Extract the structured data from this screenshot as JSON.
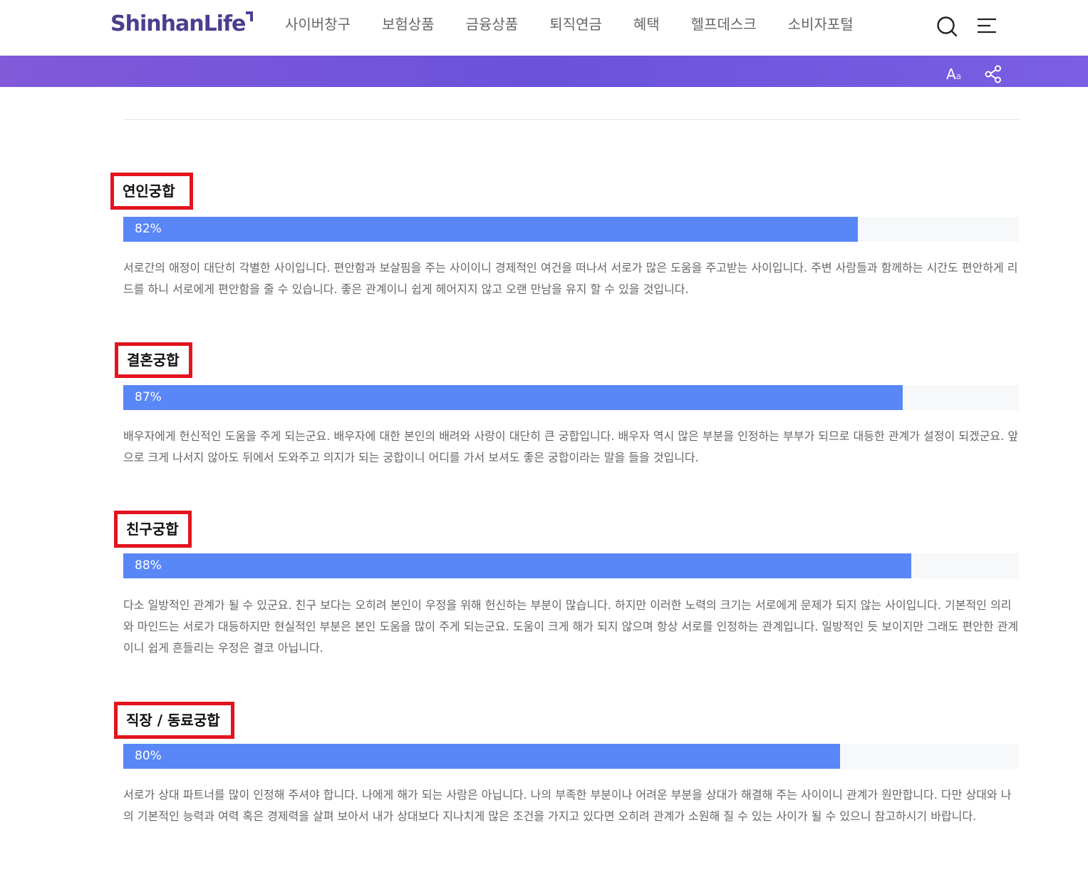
{
  "header": {
    "logo": "ShinhanLife",
    "nav": [
      "사이버창구",
      "보험상품",
      "금융상품",
      "퇴직연금",
      "혜택",
      "헬프데스크",
      "소비자포털"
    ]
  },
  "toolbar": {
    "font_size_big": "A",
    "font_size_small": "a"
  },
  "sections": [
    {
      "title": "연인궁합",
      "percent_label": "82%",
      "percent": 82,
      "description": "서로간의 애정이 대단히 각별한 사이입니다. 편안함과 보살핌을 주는 사이이니 경제적인 여건을 떠나서 서로가 많은 도움을 주고받는 사이입니다. 주변 사람들과 함께하는 시간도 편안하게 리드를 하니 서로에게 편안함을 줄 수 있습니다. 좋은 관계이니 쉽게 헤어지지 않고 오랜 만남을 유지 할 수 있을 것입니다."
    },
    {
      "title": "결혼궁합",
      "percent_label": "87%",
      "percent": 87,
      "description": "배우자에게 헌신적인 도움을 주게 되는군요. 배우자에 대한 본인의 배려와 사랑이 대단히 큰 궁합입니다. 배우자 역시 많은 부분을 인정하는 부부가 되므로 대등한 관계가 설정이 되겠군요. 앞으로 크게 나서지 않아도 뒤에서 도와주고 의지가 되는 궁합이니 어디를 가서 보셔도 좋은 궁합이라는 말을 들을 것입니다."
    },
    {
      "title": "친구궁합",
      "percent_label": "88%",
      "percent": 88,
      "description": "다소 일방적인 관계가 될 수 있군요. 친구 보다는 오히려 본인이 우정을 위해 헌신하는 부분이 많습니다. 하지만 이러한 노력의 크기는 서로에게 문제가 되지 않는 사이입니다. 기본적인 의리와 마인드는 서로가 대등하지만 현실적인 부분은 본인 도움을 많이 주게 되는군요. 도움이 크게 해가 되지 않으며 항상 서로를 인정하는 관계입니다. 일방적인 듯 보이지만 그래도 편안한 관계이니 쉽게 흔들리는 우정은 결코 아닙니다."
    },
    {
      "title": "직장 / 동료궁합",
      "percent_label": "80%",
      "percent": 80,
      "description": "서로가 상대 파트너를 많이 인정해 주셔야 합니다. 나에게 해가 되는 사람은 아닙니다. 나의 부족한 부분이나 어려운 부분을 상대가 해결해 주는 사이이니 관계가 원만합니다. 다만 상대와 나의 기본적인 능력과 여력 혹은 경제력을 살펴 보아서 내가 상대보다 지나치게 많은 조건을 가지고 있다면 오히려 관계가 소원해 질 수 있는 사이가 될 수 있으니 참고하시기 바랍니다."
    }
  ],
  "colors": {
    "brand": "#4a3f8f",
    "banner": "#6a52db",
    "bar": "#5a87f7",
    "highlight": "#e3141e"
  }
}
